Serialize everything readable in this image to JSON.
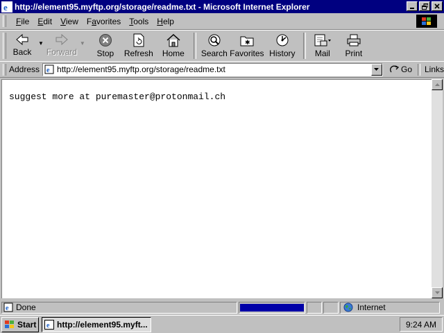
{
  "window": {
    "title": "http://element95.myftp.org/storage/readme.txt - Microsoft Internet Explorer",
    "caption_buttons": {
      "minimize": "minimize-icon",
      "maximize": "restore-icon",
      "close": "close-icon"
    }
  },
  "menubar": {
    "items": [
      {
        "accel": "F",
        "rest": "ile"
      },
      {
        "accel": "E",
        "rest": "dit"
      },
      {
        "accel": "V",
        "rest": "iew"
      },
      {
        "pre": "F",
        "accel": "a",
        "rest": "vorites"
      },
      {
        "accel": "T",
        "rest": "ools"
      },
      {
        "accel": "H",
        "rest": "elp"
      }
    ]
  },
  "toolbar": {
    "back": "Back",
    "forward": "Forward",
    "stop": "Stop",
    "refresh": "Refresh",
    "home": "Home",
    "search": "Search",
    "favorites": "Favorites",
    "history": "History",
    "mail": "Mail",
    "print": "Print"
  },
  "address": {
    "label": "Address",
    "url": "http://element95.myftp.org/storage/readme.txt",
    "go": "Go",
    "links": "Links"
  },
  "content": {
    "text": "suggest more at puremaster@protonmail.ch"
  },
  "status": {
    "text": "Done",
    "progress_fraction": 1.0,
    "zone": "Internet"
  },
  "taskbar": {
    "start": "Start",
    "task": "http://element95.myft...",
    "clock": "9:24 AM"
  },
  "colors": {
    "titlebar": "#000080",
    "face": "#c0c0c0",
    "progress": "#0000a8"
  }
}
